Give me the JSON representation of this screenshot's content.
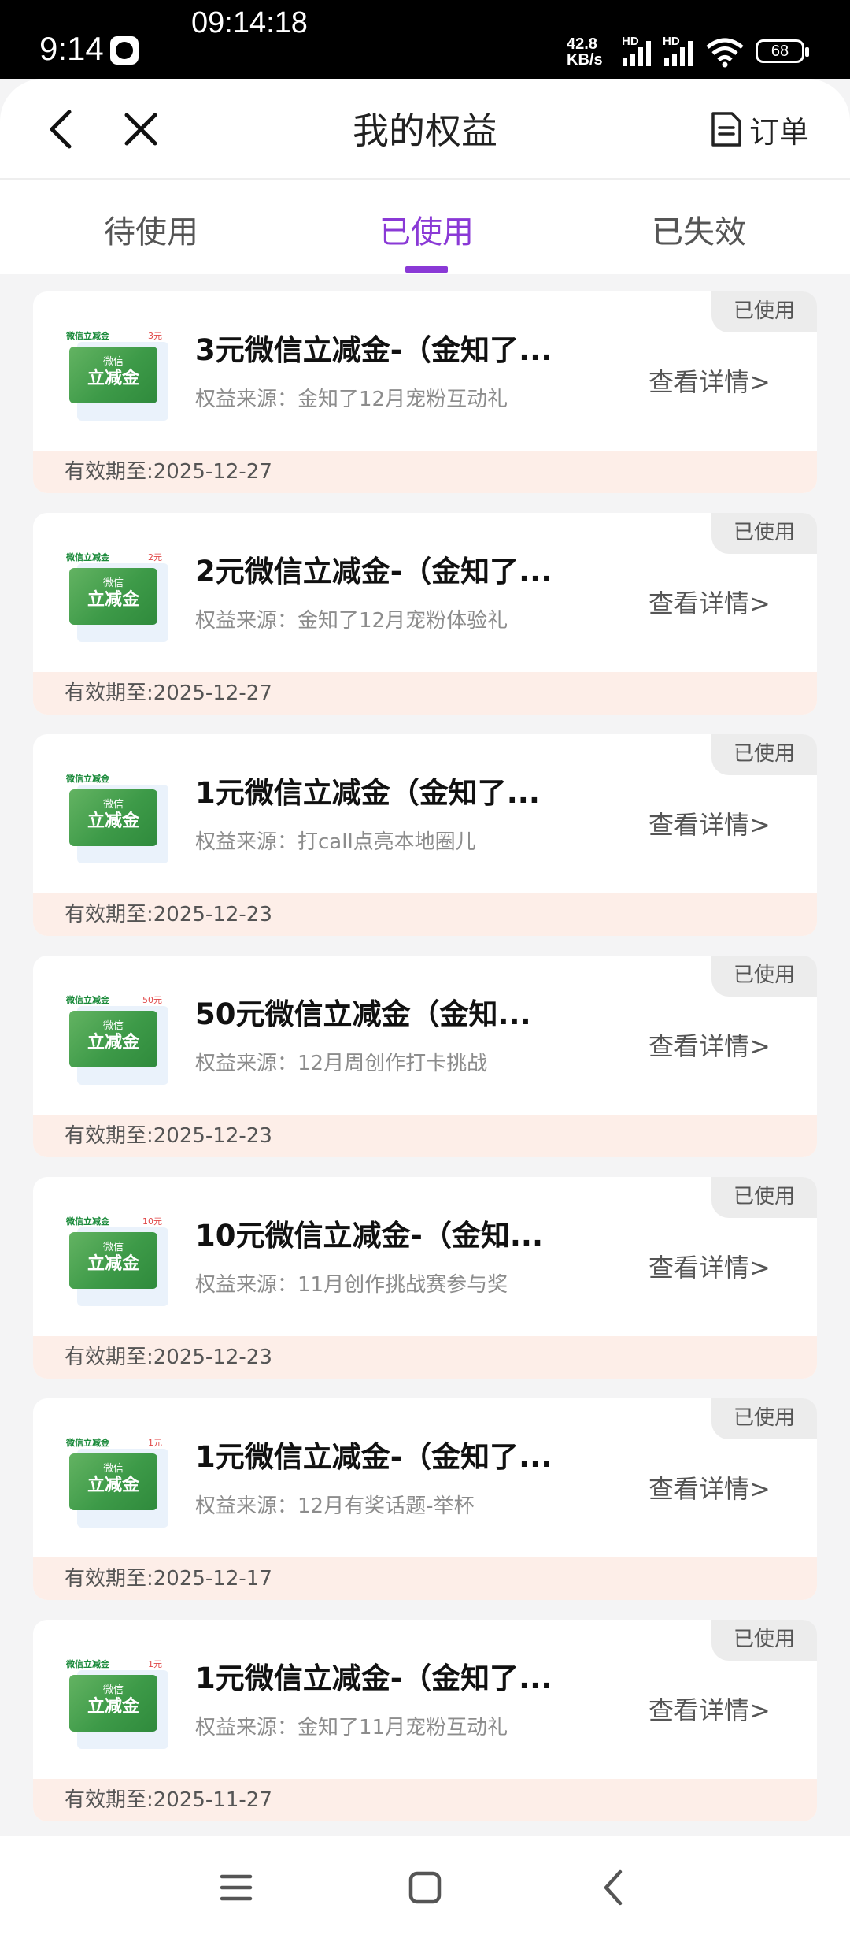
{
  "status_bar": {
    "time": "9:14",
    "clock_overlay": "09:14:18",
    "net_speed_top": "42.8",
    "net_speed_bottom": "KB/s",
    "hd1": "HD",
    "hd2": "HD",
    "battery": "68"
  },
  "header": {
    "title": "我的权益",
    "order_label": "订单"
  },
  "tabs": [
    {
      "label": "待使用",
      "active": false
    },
    {
      "label": "已使用",
      "active": true
    },
    {
      "label": "已失效",
      "active": false
    }
  ],
  "thumb_labels": {
    "top": "微信立减金",
    "line1": "微信",
    "line2": "立减金"
  },
  "cards": [
    {
      "tag": "已使用",
      "title": "3元微信立减金-（金知了...",
      "source": "权益来源：金知了12月宠粉互动礼",
      "detail": "查看详情>",
      "expire": "有效期至:2025-12-27",
      "amount": "3元"
    },
    {
      "tag": "已使用",
      "title": "2元微信立减金-（金知了...",
      "source": "权益来源：金知了12月宠粉体验礼",
      "detail": "查看详情>",
      "expire": "有效期至:2025-12-27",
      "amount": "2元"
    },
    {
      "tag": "已使用",
      "title": "1元微信立减金（金知了...",
      "source": "权益来源：打call点亮本地圈儿",
      "detail": "查看详情>",
      "expire": "有效期至:2025-12-23",
      "amount": ""
    },
    {
      "tag": "已使用",
      "title": "50元微信立减金（金知...",
      "source": "权益来源：12月周创作打卡挑战",
      "detail": "查看详情>",
      "expire": "有效期至:2025-12-23",
      "amount": "50元"
    },
    {
      "tag": "已使用",
      "title": "10元微信立减金-（金知...",
      "source": "权益来源：11月创作挑战赛参与奖",
      "detail": "查看详情>",
      "expire": "有效期至:2025-12-23",
      "amount": "10元"
    },
    {
      "tag": "已使用",
      "title": "1元微信立减金-（金知了...",
      "source": "权益来源：12月有奖话题-举杯",
      "detail": "查看详情>",
      "expire": "有效期至:2025-12-17",
      "amount": "1元"
    },
    {
      "tag": "已使用",
      "title": "1元微信立减金-（金知了...",
      "source": "权益来源：金知了11月宠粉互动礼",
      "detail": "查看详情>",
      "expire": "有效期至:2025-11-27",
      "amount": "1元"
    }
  ],
  "colors": {
    "accent": "#8a39d6",
    "expire_bg": "#fdeee8",
    "green": "#3d9a48"
  }
}
